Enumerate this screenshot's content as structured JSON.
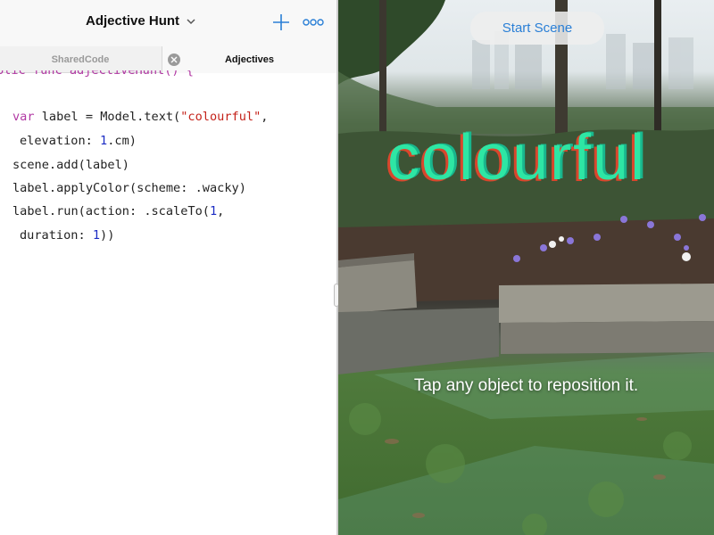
{
  "editor": {
    "title": "Adjective Hunt",
    "title_menu_icon": "chevron-down-icon",
    "add_icon": "plus-icon",
    "more_icon": "ellipsis-icon",
    "tabs": [
      {
        "label": "SharedCode",
        "active": false
      },
      {
        "label": "Adjectives",
        "active": true
      }
    ],
    "tab_close_icon": "close-circle-icon",
    "code_lines": [
      "blic func adjectiveHunt() {",
      "var label = Model.text(\"colourful\",",
      "elevation: 1.cm)",
      "scene.add(label)",
      "label.applyColor(scheme: .wacky)",
      "label.run(action: .scaleTo(1,",
      "duration: 1))"
    ]
  },
  "scene": {
    "start_button": "Start Scene",
    "ar_text": "colourful",
    "hint": "Tap any object to reposition it."
  },
  "colors": {
    "accent": "#2a7fd6",
    "keyword": "#b23aa4",
    "string": "#c4221a",
    "number": "#1c2cc4",
    "ar_text": "#2ee6a4",
    "ar_shadow": "#d9462c"
  }
}
